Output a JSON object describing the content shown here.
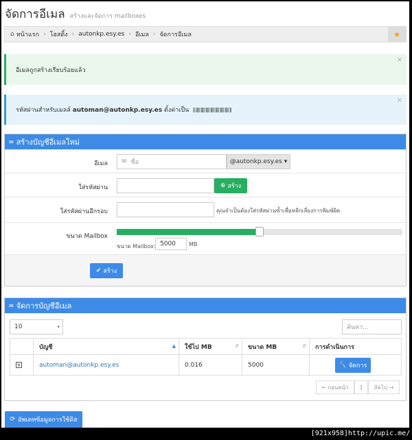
{
  "header": {
    "title": "จัดการอีเมล",
    "subtitle": "สร้างและจัดการ mailboxes"
  },
  "breadcrumb": {
    "items": [
      "หน้าแรก",
      "โฮสติ้ง",
      "autonkp.esy.es",
      "อีเมล",
      "จัดการอีเมล"
    ]
  },
  "alerts": {
    "success": "อีเมลถูกสร้างเรียบร้อยแล้ว",
    "info_prefix": "รหัสผ่านสำหรับเมลล์",
    "info_email": "automan@autonkp.esy.es",
    "info_suffix": "ตั้งค่าเป็น",
    "close": "×"
  },
  "create_panel": {
    "title": "สร้างบัญชีอีเมลใหม่",
    "email_label": "อีเมล",
    "email_placeholder": "ชื่อ",
    "domain": "@autonkp.esy.es ▾",
    "password_label": "ใส่รหัสผ่าน",
    "generate_button": "สร้าง",
    "confirm_label": "ใส่รหัสผ่านอีกรอบ",
    "confirm_hint": "คุณจำเป็นต้องใส่รหัสผ่านซ้ำเพื่อหลีกเลี่ยงการพิมพ์ผิด",
    "mailbox_label": "ขนาด Mailbox",
    "mailbox_size_label": "ขนาด Mailbox:",
    "mailbox_size_value": "5000",
    "mailbox_size_unit": "MB",
    "mailbox_slider_fraction": 0.5,
    "submit_button": "สร้าง"
  },
  "manage_panel": {
    "title": "จัดการบัญชีอีเมล",
    "page_size": "10",
    "search_placeholder": "ค้นหา...",
    "columns": [
      "บัญชี",
      "ใช้ไป MB",
      "ขนาด MB",
      "การดำเนินการ"
    ],
    "rows": [
      {
        "expand": "+",
        "account": "automan@autonkp.esy.es",
        "used": "0.016",
        "size": "5000",
        "action": "จัดการ"
      }
    ],
    "pager": {
      "prev": "← ก่อนหน้า",
      "page": "1",
      "next": "ถัดไป →"
    }
  },
  "update_button": "อัพเดทข้อมูลการใช้ดิส",
  "watermark": "[921x958]http://upic.me/",
  "colors": {
    "primary": "#3d8be6",
    "success": "#27ae60",
    "link": "#2a7ab8",
    "star": "#f39c12"
  }
}
